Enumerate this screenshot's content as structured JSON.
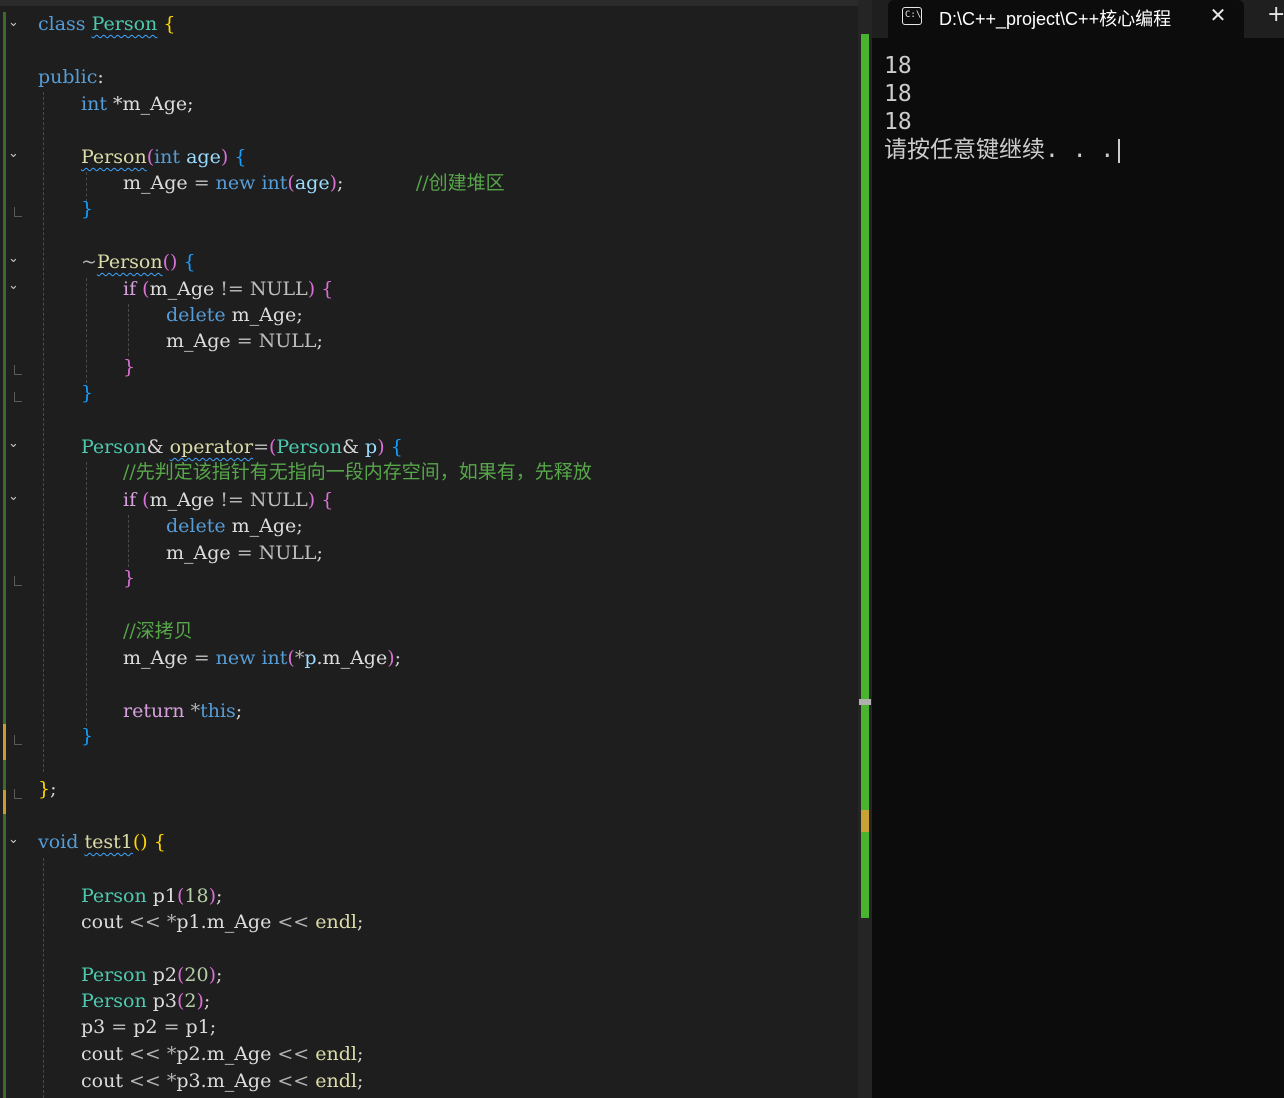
{
  "console": {
    "tab_title": "D:\\C++_project\\C++核心编程",
    "icon_text": "C:\\",
    "close_glyph": "✕",
    "add_glyph": "+",
    "output": [
      "18",
      "18",
      "18",
      "请按任意键继续. . ."
    ]
  },
  "colors": {
    "editor_bg": "#1e1e1e",
    "console_bg": "#0c0c0c",
    "keyword": "#569cd6",
    "type": "#4ec9b0",
    "comment": "#57a64a",
    "change_bar": "#3a6b2c",
    "scroll_track": "#4bb42e"
  },
  "code": {
    "l1": {
      "kw": "class",
      "name": "Person",
      "brace": "{"
    },
    "l3": {
      "kw": "public",
      "colon": ":"
    },
    "l4": {
      "type": "int",
      "rest": " *m_Age;"
    },
    "l6": {
      "name": "Person",
      "open": "(",
      "type": "int",
      "param": " age",
      "close": ")",
      "brace": "{"
    },
    "l7": {
      "member": "m_Age",
      "eq": " = ",
      "kw": "new",
      "type": "int",
      "open": "(",
      "param": "age",
      "close": ")",
      "semi": ";",
      "comment": "//创建堆区"
    },
    "l8": {
      "brace": "}"
    },
    "l10": {
      "tilde": "~",
      "name": "Person",
      "parens": "()",
      "brace": "{"
    },
    "l11": {
      "kw": "if",
      "open": "(",
      "member": "m_Age",
      "op": " != ",
      "macro": "NULL",
      "close": ")",
      "brace": "{"
    },
    "l12": {
      "kw": "delete",
      "member": "m_Age",
      "semi": ";"
    },
    "l13": {
      "member": "m_Age",
      "eq": " = ",
      "macro": "NULL",
      "semi": ";"
    },
    "l14": {
      "brace": "}"
    },
    "l15": {
      "brace": "}"
    },
    "l17": {
      "type": "Person",
      "amp": "& ",
      "fn": "operator",
      "eq": "=",
      "open": "(",
      "ptype": "Person",
      "pamp": "& ",
      "param": "p",
      "close": ")",
      "brace": "{"
    },
    "l18": {
      "comment": "//先判定该指针有无指向一段内存空间，如果有，先释放"
    },
    "l19": {
      "kw": "if",
      "open": "(",
      "member": "m_Age",
      "op": " != ",
      "macro": "NULL",
      "close": ")",
      "brace": "{"
    },
    "l20": {
      "kw": "delete",
      "member": "m_Age",
      "semi": ";"
    },
    "l21": {
      "member": "m_Age",
      "eq": " = ",
      "macro": "NULL",
      "semi": ";"
    },
    "l22": {
      "brace": "}"
    },
    "l24": {
      "comment": "//深拷贝"
    },
    "l25": {
      "member": "m_Age",
      "eq": " = ",
      "kw": "new",
      "type": "int",
      "open": "(",
      "star": "*",
      "param": "p",
      "dot": ".",
      "member2": "m_Age",
      "close": ")",
      "semi": ";"
    },
    "l27": {
      "kw": "return",
      "star": " *",
      "kw2": "this",
      "semi": ";"
    },
    "l28": {
      "brace": "}"
    },
    "l30": {
      "brace": "}",
      "semi": ";"
    },
    "l32": {
      "kw": "void",
      "fn": "test1",
      "parens": "()",
      "brace": "{"
    },
    "l34": {
      "type": "Person",
      "var": " p1",
      "open": "(",
      "num": "18",
      "close": ")",
      "semi": ";"
    },
    "l35": {
      "var": "cout",
      "op": " << ",
      "star": "*",
      "v2": "p1",
      "dot": ".",
      "member": "m_Age",
      "op2": " << ",
      "fn": "endl",
      "semi": ";"
    },
    "l37": {
      "type": "Person",
      "var": " p2",
      "open": "(",
      "num": "20",
      "close": ")",
      "semi": ";"
    },
    "l38": {
      "type": "Person",
      "var": " p3",
      "open": "(",
      "num": "2",
      "close": ")",
      "semi": ";"
    },
    "l39": {
      "v1": "p3",
      "eq": " = ",
      "v2": "p2",
      "eq2": " = ",
      "v3": "p1",
      "semi": ";"
    },
    "l40": {
      "var": "cout",
      "op": " << ",
      "star": "*",
      "v2": "p2",
      "dot": ".",
      "member": "m_Age",
      "op2": " << ",
      "fn": "endl",
      "semi": ";"
    },
    "l41": {
      "var": "cout",
      "op": " << ",
      "star": "*",
      "v2": "p3",
      "dot": ".",
      "member": "m_Age",
      "op2": " << ",
      "fn": "endl",
      "semi": ";"
    }
  }
}
